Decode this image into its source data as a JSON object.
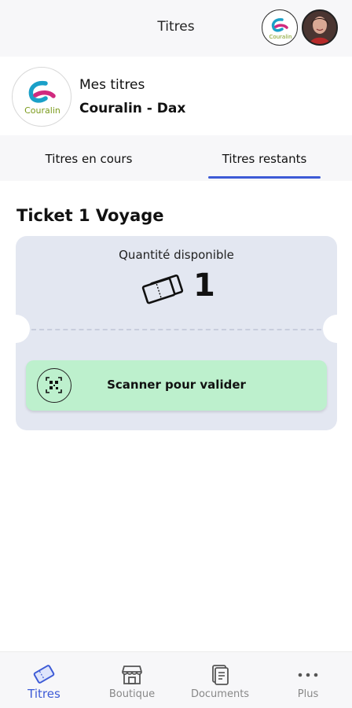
{
  "header": {
    "title": "Titres"
  },
  "network": {
    "title": "Mes titres",
    "name": "Couralin - Dax",
    "logo_text": "Couralin"
  },
  "tabs": [
    {
      "label": "Titres en cours",
      "active": false
    },
    {
      "label": "Titres restants",
      "active": true
    }
  ],
  "ticket": {
    "title": "Ticket 1 Voyage",
    "quantity_label": "Quantité disponible",
    "quantity": "1",
    "scan_label": "Scanner pour valider"
  },
  "bottom_nav": [
    {
      "label": "Titres",
      "icon": "ticket-icon",
      "active": true
    },
    {
      "label": "Boutique",
      "icon": "shop-icon",
      "active": false
    },
    {
      "label": "Documents",
      "icon": "documents-icon",
      "active": false
    },
    {
      "label": "Plus",
      "icon": "more-icon",
      "active": false
    }
  ],
  "colors": {
    "accent": "#3d5bd6",
    "scan_button": "#bdf0cd",
    "ticket_card": "#e3e7f1",
    "header_bg": "#f7f7f9"
  }
}
